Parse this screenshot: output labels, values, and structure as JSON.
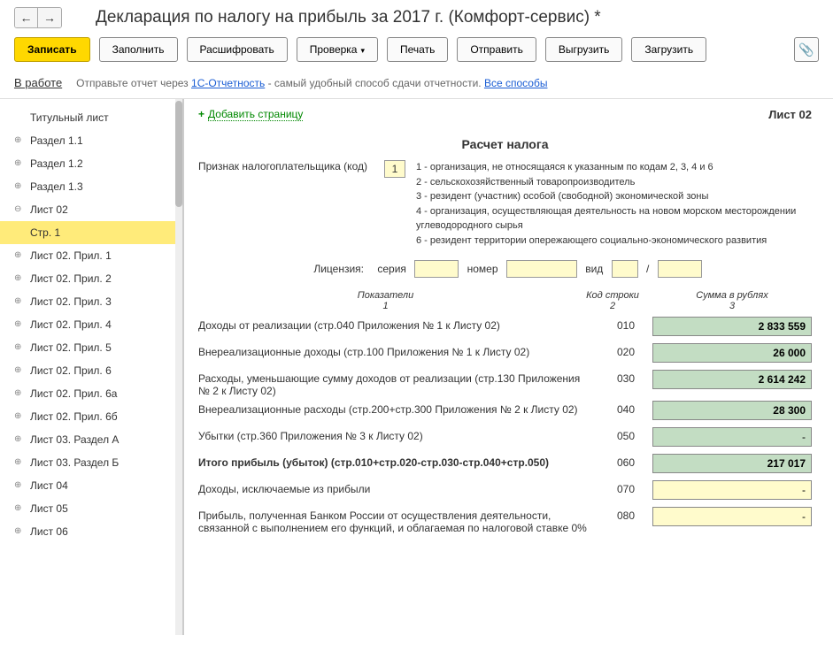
{
  "title": "Декларация по налогу на прибыль за 2017 г. (Комфорт-сервис) *",
  "toolbar": {
    "save": "Записать",
    "fill": "Заполнить",
    "decode": "Расшифровать",
    "check": "Проверка",
    "print": "Печать",
    "send": "Отправить",
    "upload": "Выгрузить",
    "download": "Загрузить"
  },
  "status": {
    "label": "В работе",
    "hint_pre": "Отправьте отчет через ",
    "hint_link1": "1С-Отчетность",
    "hint_post": " - самый удобный способ сдачи отчетности. ",
    "hint_link2": "Все способы"
  },
  "tree": [
    {
      "label": "Титульный лист",
      "expand": "",
      "level": 1
    },
    {
      "label": "Раздел 1.1",
      "expand": "⊕",
      "level": 1
    },
    {
      "label": "Раздел 1.2",
      "expand": "⊕",
      "level": 1
    },
    {
      "label": "Раздел 1.3",
      "expand": "⊕",
      "level": 1
    },
    {
      "label": "Лист 02",
      "expand": "⊖",
      "level": 1
    },
    {
      "label": "Стр. 1",
      "expand": "",
      "level": 2,
      "selected": true
    },
    {
      "label": "Лист 02. Прил. 1",
      "expand": "⊕",
      "level": 1
    },
    {
      "label": "Лист 02. Прил. 2",
      "expand": "⊕",
      "level": 1
    },
    {
      "label": "Лист 02. Прил. 3",
      "expand": "⊕",
      "level": 1
    },
    {
      "label": "Лист 02. Прил. 4",
      "expand": "⊕",
      "level": 1
    },
    {
      "label": "Лист 02. Прил. 5",
      "expand": "⊕",
      "level": 1
    },
    {
      "label": "Лист 02. Прил. 6",
      "expand": "⊕",
      "level": 1
    },
    {
      "label": "Лист 02. Прил. 6а",
      "expand": "⊕",
      "level": 1
    },
    {
      "label": "Лист 02. Прил. 6б",
      "expand": "⊕",
      "level": 1
    },
    {
      "label": "Лист 03. Раздел А",
      "expand": "⊕",
      "level": 1
    },
    {
      "label": "Лист 03. Раздел Б",
      "expand": "⊕",
      "level": 1
    },
    {
      "label": "Лист 04",
      "expand": "⊕",
      "level": 1
    },
    {
      "label": "Лист 05",
      "expand": "⊕",
      "level": 1
    },
    {
      "label": "Лист 06",
      "expand": "⊕",
      "level": 1
    }
  ],
  "main": {
    "add_page": "Добавить страницу",
    "sheet_title": "Лист 02",
    "section_title": "Расчет налога",
    "taxpayer_label": "Признак налогоплательщика (код)",
    "taxpayer_code": "1",
    "taxpayer_desc": "1 - организация, не относящаяся к указанным по кодам 2, 3, 4 и 6\n2 - сельскохозяйственный товаропроизводитель\n3 - резидент (участник) особой (свободной) экономической зоны\n4 - организация, осуществляющая деятельность на новом морском месторождении углеводородного сырья\n6 - резидент территории опережающего социально-экономического развития",
    "license": {
      "label": "Лицензия:",
      "serial": "серия",
      "number": "номер",
      "type": "вид",
      "slash": "/"
    },
    "columns": {
      "indicator": "Показатели",
      "indicator_n": "1",
      "code": "Код строки",
      "code_n": "2",
      "sum": "Сумма в рублях",
      "sum_n": "3"
    },
    "rows": [
      {
        "label": "Доходы от реализации (стр.040 Приложения № 1 к Листу 02)",
        "code": "010",
        "value": "2 833 559",
        "style": "green"
      },
      {
        "label": "Внереализационные доходы (стр.100 Приложения № 1 к Листу 02)",
        "code": "020",
        "value": "26 000",
        "style": "green"
      },
      {
        "label": "Расходы, уменьшающие сумму доходов от реализации (стр.130 Приложения № 2 к Листу 02)",
        "code": "030",
        "value": "2 614 242",
        "style": "green"
      },
      {
        "label": "Внереализационные расходы (стр.200+стр.300 Приложения № 2 к Листу 02)",
        "code": "040",
        "value": "28 300",
        "style": "green"
      },
      {
        "label": "Убытки (стр.360 Приложения № 3 к Листу 02)",
        "code": "050",
        "value": "-",
        "style": "green"
      },
      {
        "label": "Итого прибыль (убыток)    (стр.010+стр.020-стр.030-стр.040+стр.050)",
        "code": "060",
        "value": "217 017",
        "style": "green",
        "bold": true
      },
      {
        "label": "Доходы, исключаемые из прибыли",
        "code": "070",
        "value": "-",
        "style": "yellow"
      },
      {
        "label": "Прибыль, полученная Банком России от осуществления деятельности, связанной с выполнением его функций, и облагаемая по налоговой ставке 0%",
        "code": "080",
        "value": "-",
        "style": "yellow"
      }
    ]
  }
}
